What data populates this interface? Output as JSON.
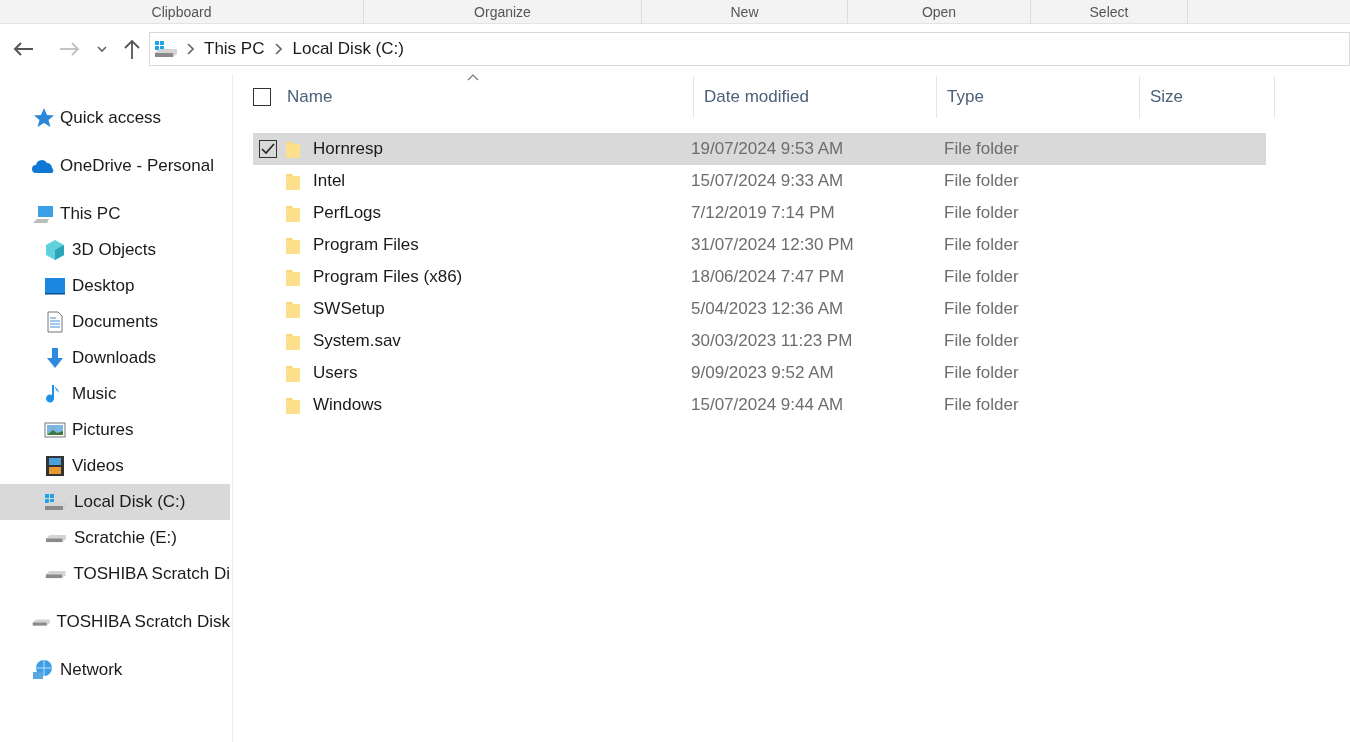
{
  "ribbon_groups": [
    "Clipboard",
    "Organize",
    "New",
    "Open",
    "Select"
  ],
  "address_bar": {
    "crumbs": [
      "This PC",
      "Local Disk (C:)"
    ]
  },
  "sidebar": {
    "items": [
      {
        "label": "Quick access",
        "kind": "star",
        "selected": false
      },
      {
        "label": "OneDrive - Personal",
        "kind": "cloud",
        "selected": false
      },
      {
        "label": "This PC",
        "kind": "pc",
        "selected": false,
        "children": [
          {
            "label": "3D Objects",
            "kind": "cube",
            "selected": false
          },
          {
            "label": "Desktop",
            "kind": "desktop",
            "selected": false
          },
          {
            "label": "Documents",
            "kind": "document",
            "selected": false
          },
          {
            "label": "Downloads",
            "kind": "download",
            "selected": false
          },
          {
            "label": "Music",
            "kind": "music",
            "selected": false
          },
          {
            "label": "Pictures",
            "kind": "picture",
            "selected": false
          },
          {
            "label": "Videos",
            "kind": "video",
            "selected": false
          },
          {
            "label": "Local Disk (C:)",
            "kind": "system-drive",
            "selected": true
          },
          {
            "label": "Scratchie (E:)",
            "kind": "drive",
            "selected": false
          },
          {
            "label": "TOSHIBA Scratch Di",
            "kind": "drive",
            "selected": false
          }
        ]
      },
      {
        "label": "TOSHIBA Scratch Disk",
        "kind": "drive",
        "selected": false
      },
      {
        "label": "Network",
        "kind": "network",
        "selected": false
      }
    ]
  },
  "table": {
    "columns": [
      "Name",
      "Date modified",
      "Type",
      "Size"
    ],
    "header_checked": false,
    "rows": [
      {
        "name": "Hornresp",
        "date": "19/07/2024 9:53 AM",
        "type": "File folder",
        "selected": true,
        "checked": true
      },
      {
        "name": "Intel",
        "date": "15/07/2024 9:33 AM",
        "type": "File folder",
        "selected": false,
        "checked": false
      },
      {
        "name": "PerfLogs",
        "date": "7/12/2019 7:14 PM",
        "type": "File folder",
        "selected": false,
        "checked": false
      },
      {
        "name": "Program Files",
        "date": "31/07/2024 12:30 PM",
        "type": "File folder",
        "selected": false,
        "checked": false
      },
      {
        "name": "Program Files (x86)",
        "date": "18/06/2024 7:47 PM",
        "type": "File folder",
        "selected": false,
        "checked": false
      },
      {
        "name": "SWSetup",
        "date": "5/04/2023 12:36 AM",
        "type": "File folder",
        "selected": false,
        "checked": false
      },
      {
        "name": "System.sav",
        "date": "30/03/2023 11:23 PM",
        "type": "File folder",
        "selected": false,
        "checked": false
      },
      {
        "name": "Users",
        "date": "9/09/2023 9:52 AM",
        "type": "File folder",
        "selected": false,
        "checked": false
      },
      {
        "name": "Windows",
        "date": "15/07/2024 9:44 AM",
        "type": "File folder",
        "selected": false,
        "checked": false
      }
    ]
  }
}
